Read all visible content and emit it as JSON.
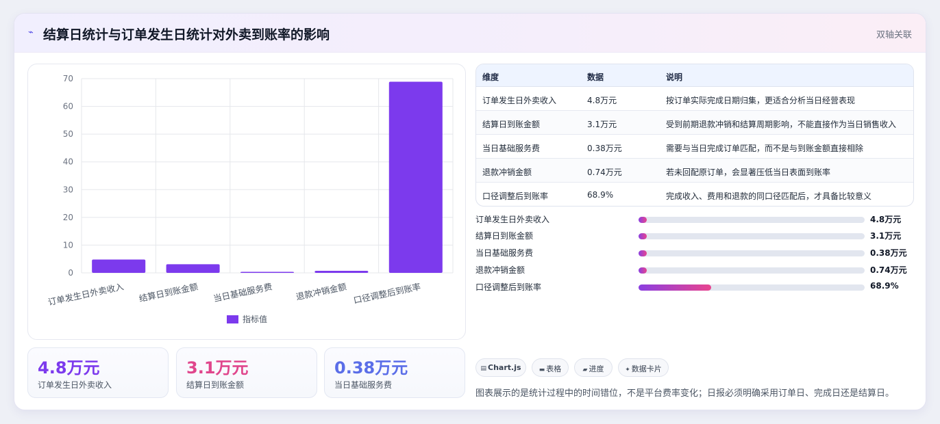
{
  "header": {
    "icon": "pulse-line-icon",
    "title": "结算日统计与订单发生日统计对外卖到账率的影响",
    "tag": "双轴关联"
  },
  "chart_data": {
    "type": "bar",
    "categories": [
      "订单发生日外卖收入",
      "结算日到账金额",
      "当日基础服务费",
      "退款冲销金额",
      "口径调整后到账率"
    ],
    "series": [
      {
        "name": "指标值",
        "values": [
          4.8,
          3.1,
          0.38,
          0.74,
          68.9
        ]
      }
    ],
    "ylim": [
      0,
      70
    ],
    "yticks": [
      "0",
      "10",
      "20",
      "30",
      "40",
      "50",
      "60",
      "70"
    ],
    "grid": true,
    "legend_position": "bottom",
    "bar_color": "#7c3aed"
  },
  "stats": [
    {
      "value": "4.8万元",
      "label": "订单发生日外卖收入",
      "color": "#7c3aed"
    },
    {
      "value": "3.1万元",
      "label": "结算日到账金额",
      "color": "#e0468c"
    },
    {
      "value": "0.38万元",
      "label": "当日基础服务费",
      "color": "#5b6ee8"
    }
  ],
  "table": {
    "headers": [
      "维度",
      "数据",
      "说明"
    ],
    "rows": [
      [
        "订单发生日外卖收入",
        "4.8万元",
        "按订单实际完成日期归集，更适合分析当日经营表现"
      ],
      [
        "结算日到账金额",
        "3.1万元",
        "受到前期退款冲销和结算周期影响，不能直接作为当日销售收入"
      ],
      [
        "当日基础服务费",
        "0.38万元",
        "需要与当日完成订单匹配，而不是与到账金额直接相除"
      ],
      [
        "退款冲销金额",
        "0.74万元",
        "若未回配原订单，会显著压低当日表面到账率"
      ],
      [
        "口径调整后到账率",
        "68.9%",
        "完成收入、费用和退款的同口径匹配后，才具备比较意义"
      ]
    ]
  },
  "progress": [
    {
      "label": "订单发生日外卖收入",
      "value": "4.8万元",
      "fraction": 0.035
    },
    {
      "label": "结算日到账金额",
      "value": "3.1万元",
      "fraction": 0.035
    },
    {
      "label": "当日基础服务费",
      "value": "0.38万元",
      "fraction": 0.035
    },
    {
      "label": "退款冲销金额",
      "value": "0.74万元",
      "fraction": 0.035
    },
    {
      "label": "口径调整后到账率",
      "value": "68.9%",
      "fraction": 0.32
    }
  ],
  "chips": [
    {
      "icon": "chart-icon",
      "label": "Chart.js"
    },
    {
      "icon": "table-icon",
      "label": "表格"
    },
    {
      "icon": "progress-icon",
      "label": "进度"
    },
    {
      "icon": "sparkle-icon",
      "label": "数据卡片"
    }
  ],
  "note": "图表展示的是统计过程中的时间错位，不是平台费率变化；日报必须明确采用订单日、完成日还是结算日。"
}
